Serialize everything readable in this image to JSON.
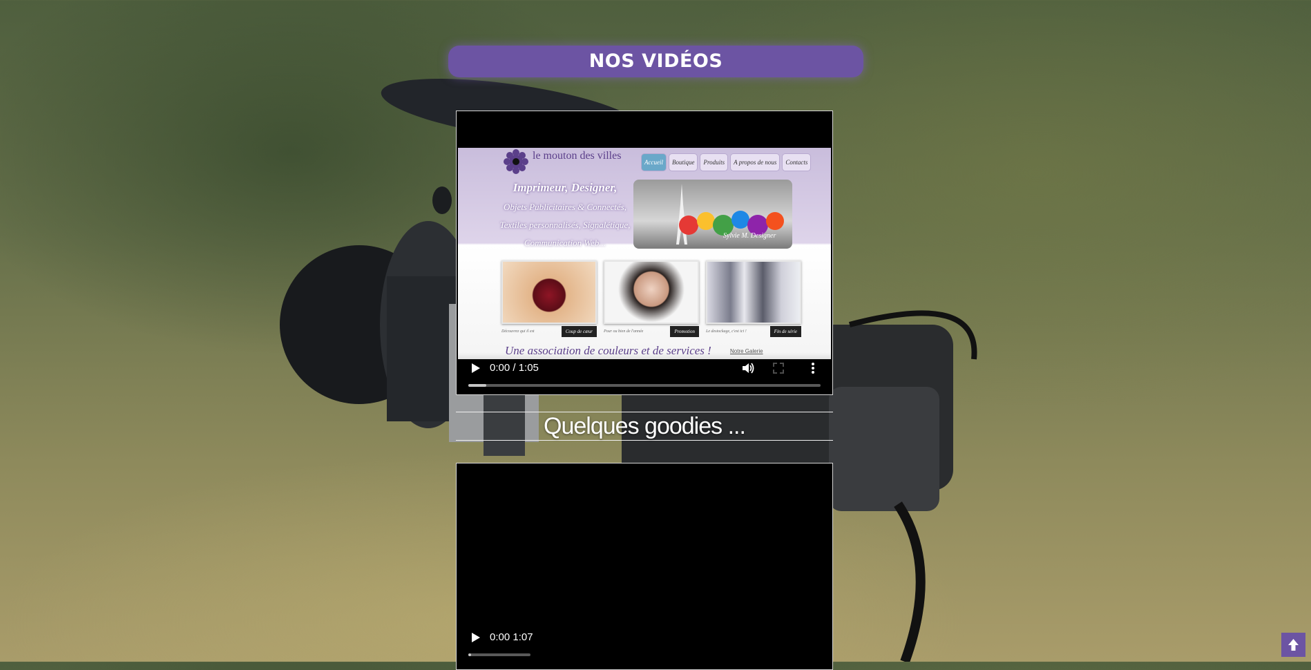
{
  "page": {
    "heading": "NOS VIDÉOS",
    "section_title": "Quelques goodies ...",
    "accent_color": "#6c54a3"
  },
  "video_1": {
    "time": "0:00 / 1:05",
    "poster": {
      "brand": "le mouton des villes",
      "nav": [
        "Accueil",
        "Boutique",
        "Produits",
        "A propos de nous",
        "Contacts"
      ],
      "lines": [
        "Imprimeur, Designer,",
        "Objets Publicitaires & Connectés,",
        "Textiles personnalisés, Signalétique,",
        "Communication Web..."
      ],
      "banner_text": "Sylvie M. Designer",
      "tile_buttons": [
        "Coup de cœur",
        "Promotion",
        "Fin de série"
      ],
      "tile_notes": [
        "Découvrez qui il est",
        "Pour ou bien de l'année",
        "Le destockage, c'est ici !"
      ],
      "slogan": "Une association de couleurs et de services !",
      "gallery_link": "Notre Galerie"
    },
    "progress_buffered": 0.05
  },
  "video_2": {
    "time": "0:00 1:07",
    "progress_buffered": 0.02
  },
  "icons": {
    "play": "play-icon",
    "volume": "volume-icon",
    "fullscreen": "fullscreen-icon",
    "more": "more-vertical-icon",
    "scroll_top": "arrow-up-icon"
  }
}
